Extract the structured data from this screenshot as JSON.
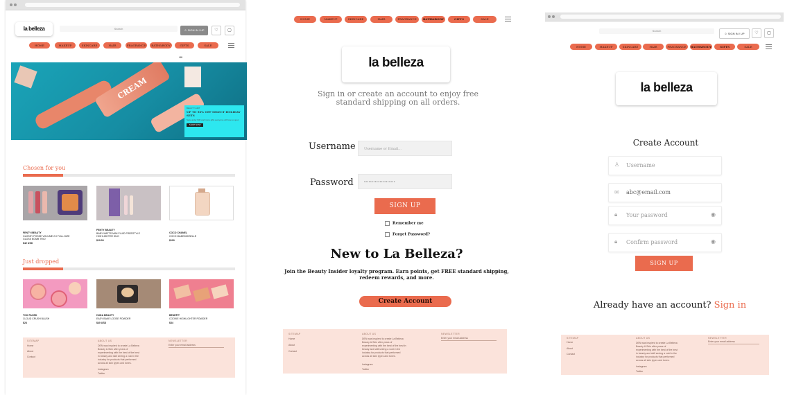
{
  "brand": "la belleza",
  "nav": [
    "HOME",
    "MAKEUP",
    "SKINCARE",
    "HAIR",
    "FRAGRANCE",
    "BATH&BODY",
    "GIFTS",
    "SALE"
  ],
  "home": {
    "search_placeholder": "Search",
    "signin_label": "SIGN IN / UP",
    "promo": {
      "kicker": "BEAUTY EDIT",
      "headline": "UP TO 50% OFF SELECT HOLIDAY SETS",
      "body": "Sets under $30 and more gifts everyone will love to open",
      "cta": "SHOP NOW",
      "product_text": "CREAM"
    },
    "chosen_title": "Chosen for you",
    "chosen": [
      {
        "brand": "FENTY BEAUTY",
        "name": "GLOSSY POSSE VOLUME 2.0 FULL-SIZE GLOSS BOMB TRIO",
        "price": "$42 USD"
      },
      {
        "brand": "FENTY BEAUTY",
        "name": "BABY WATTS MINI FLUID FREESTYLE HIGHLIGHTER DUO",
        "price": "$19.00"
      },
      {
        "brand": "COCO CHANEL",
        "name": "COCO MADEMOISELLE",
        "price": "$100"
      }
    ],
    "dropped_title": "Just dropped",
    "dropped": [
      {
        "brand": "TOO FACED",
        "name": "CLOUD CRUSH BLUSH",
        "price": "$24"
      },
      {
        "brand": "HUDA BEAUTY",
        "name": "EASY BAKE LOOSE POWDER",
        "price": "$40 USD"
      },
      {
        "brand": "BENEFIT",
        "name": "COOKIE HIGHLIGHTER POWDER",
        "price": "$34"
      }
    ]
  },
  "signin": {
    "tagline": "Sign in or create an account to enjoy free standard shipping on all orders.",
    "username_label": "Username",
    "username_placeholder": "Username or Email...",
    "password_label": "Password",
    "password_value": "••••••••••••••••••••",
    "signup_button": "SIGN UP",
    "remember": "Remember me",
    "forgot": "Forget Password?",
    "new_heading": "New to La Belleza?",
    "new_text": "Join the Beauty Insider loyalty program. Earn points, get FREE standard shipping, redeem rewards, and more.",
    "create_button": "Create Account"
  },
  "create": {
    "heading": "Create Account",
    "username": "Username",
    "email": "abc@email.com",
    "password": "Your password",
    "confirm": "Confirm password",
    "signup_button": "SIGN UP",
    "have_account": "Already have an account?",
    "signin_link": "Sign in"
  },
  "footer": {
    "col1_title": "SITEMAP",
    "links": [
      "Home",
      "About",
      "Contact"
    ],
    "col2_title": "ABOUT US",
    "about": "DEN was inspired to create La Belleza Beauty & Skin after years of experimenting with the best of the best in beauty and skill seeing a void in the industry for products that performed across all skin types and tones.",
    "social": [
      "Instagram",
      "Twitter"
    ],
    "col3_title": "NEWSLETTER",
    "email_placeholder": "Enter your email address"
  },
  "colors": {
    "accent": "#ea6b4e",
    "footer_bg": "#fbe3db",
    "hero_bg": "#1a9ab0"
  }
}
